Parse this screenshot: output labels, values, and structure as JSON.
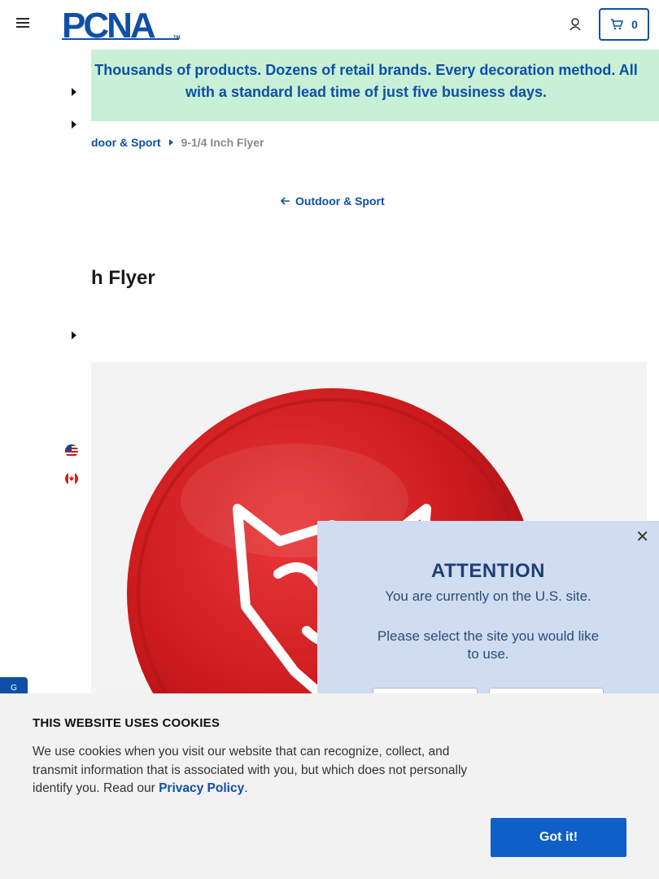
{
  "header": {
    "logo_text": "PCNA",
    "logo_tm": "TM",
    "cart_count": "0"
  },
  "banner": {
    "text": "Thousands of products. Dozens of retail brands. Every decoration method. All with a standard lead time of just five business days."
  },
  "breadcrumb": {
    "category": "door & Sport",
    "current": "9-1/4 Inch Flyer"
  },
  "back_link": {
    "label": "Outdoor & Sport"
  },
  "product": {
    "title": "h Flyer",
    "color": "#c8161b"
  },
  "side_tab": {
    "label": "G"
  },
  "modal": {
    "title": "ATTENTION",
    "message": "You are currently on the U.S. site.",
    "prompt": "Please select the site you would like to use."
  },
  "cookie": {
    "title": "THIS WEBSITE USES COOKIES",
    "text": "We use cookies when you visit our website that can recognize, collect, and transmit information that is associated with you, but which does not personally identify you. Read our",
    "link": "Privacy Policy",
    "period": ".",
    "button": "Got it!"
  },
  "colors": {
    "brand_blue": "#0f4fa8",
    "banner_green": "#c7f0d6",
    "modal_bg": "#d0dcef"
  },
  "icons": [
    "menu-icon",
    "user-icon",
    "cart-icon",
    "caret-right-icon",
    "arrow-left-icon",
    "us-flag-icon",
    "ca-flag-icon",
    "close-icon"
  ]
}
